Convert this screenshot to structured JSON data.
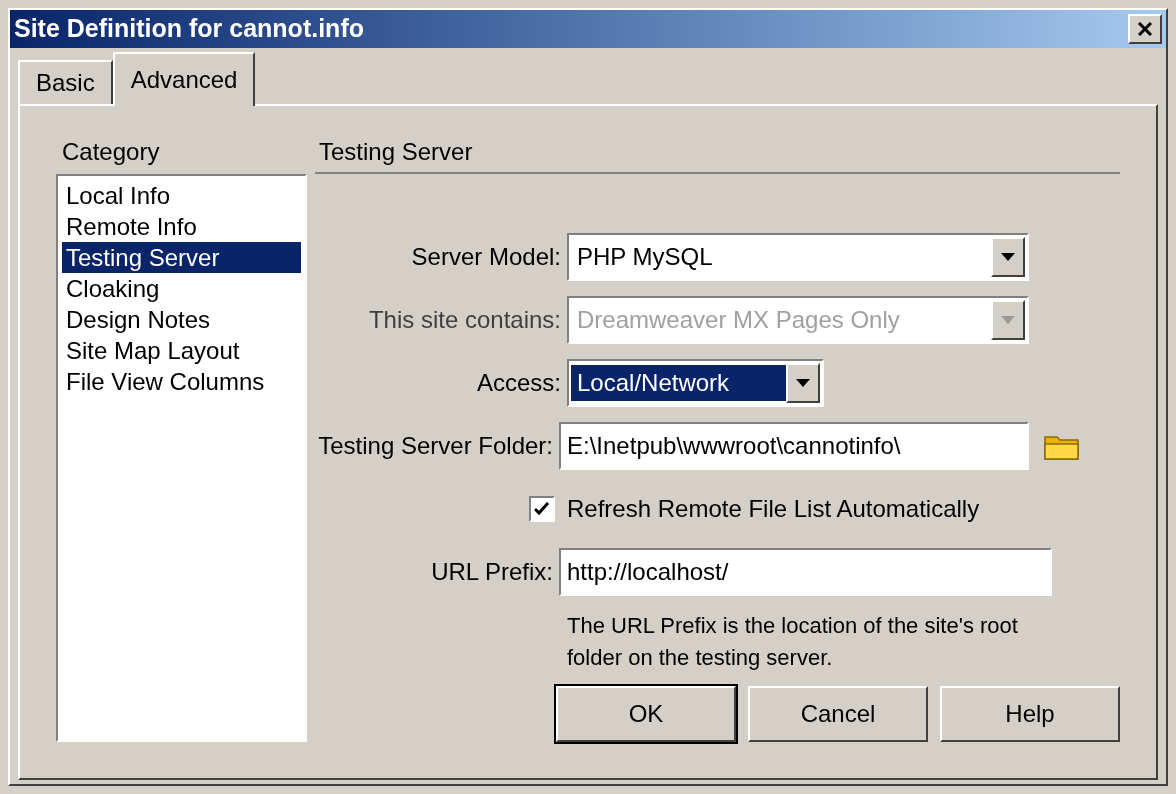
{
  "window": {
    "title": "Site Definition for cannot.info"
  },
  "tabs": [
    {
      "label": "Basic",
      "selected": false
    },
    {
      "label": "Advanced",
      "selected": true
    }
  ],
  "category": {
    "label": "Category",
    "items": [
      {
        "label": "Local Info",
        "selected": false
      },
      {
        "label": "Remote Info",
        "selected": false
      },
      {
        "label": "Testing Server",
        "selected": true
      },
      {
        "label": "Cloaking",
        "selected": false
      },
      {
        "label": "Design Notes",
        "selected": false
      },
      {
        "label": "Site Map Layout",
        "selected": false
      },
      {
        "label": "File View Columns",
        "selected": false
      }
    ]
  },
  "section": {
    "title": "Testing Server"
  },
  "fields": [
    {
      "kind": "select",
      "label": "Server Model:",
      "value": "PHP MySQL",
      "disabled": false,
      "highlighted": false
    },
    {
      "kind": "select",
      "label": "This site contains:",
      "value": "Dreamweaver MX Pages Only",
      "disabled": true,
      "highlighted": false
    },
    {
      "kind": "select",
      "label": "Access:",
      "value": "Local/Network",
      "disabled": false,
      "highlighted": true
    },
    {
      "kind": "folder",
      "label": "Testing Server Folder:",
      "value": "E:\\Inetpub\\wwwroot\\cannotinfo\\"
    },
    {
      "kind": "checkbox",
      "label": "Refresh Remote File List Automatically",
      "checked": true
    },
    {
      "kind": "text",
      "label": "URL Prefix:",
      "value": "http://localhost/"
    },
    {
      "kind": "note",
      "text": "The URL Prefix is the location of the site's root folder on the testing server."
    }
  ],
  "buttons": [
    {
      "label": "OK",
      "default": true
    },
    {
      "label": "Cancel",
      "default": false
    },
    {
      "label": "Help",
      "default": false
    }
  ]
}
